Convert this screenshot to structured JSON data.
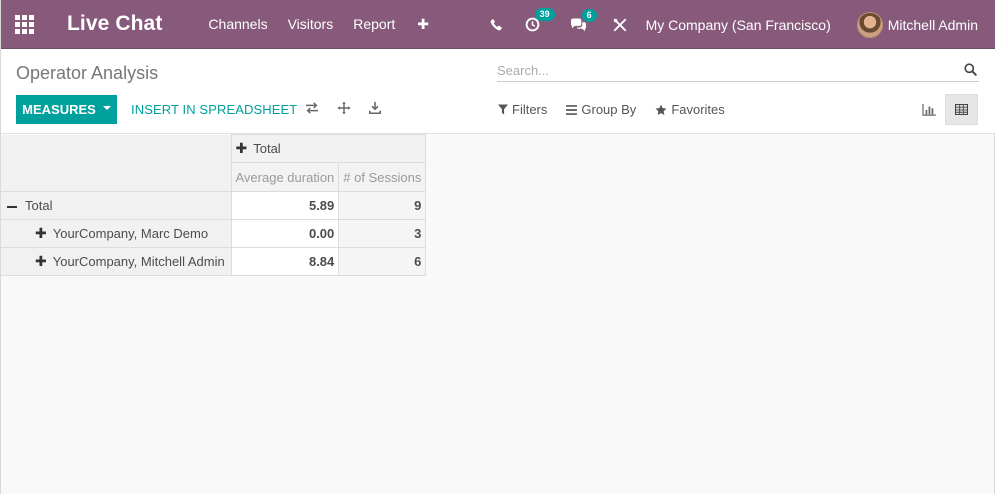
{
  "navbar": {
    "brand": "Live Chat",
    "menu": [
      "Channels",
      "Visitors",
      "Report"
    ],
    "activity_badge": "39",
    "message_badge": "6",
    "company": "My Company (San Francisco)",
    "user": "Mitchell Admin"
  },
  "control_panel": {
    "breadcrumb": "Operator Analysis",
    "search_placeholder": "Search...",
    "measures_label": "MEASURES",
    "spreadsheet_label": "INSERT IN SPREADSHEET",
    "filters_label": "Filters",
    "groupby_label": "Group By",
    "favorites_label": "Favorites",
    "icons": [
      "flip-axis-icon",
      "expand-all-icon",
      "download-icon",
      "bar-chart-icon",
      "table-icon"
    ]
  },
  "pivot": {
    "col_header": "Total",
    "measures": [
      "Average duration",
      "# of Sessions"
    ],
    "total_label": "Total",
    "total_values": [
      "5.89",
      "9"
    ],
    "rows": [
      {
        "label": "YourCompany, Marc Demo",
        "values": [
          "0.00",
          "3"
        ]
      },
      {
        "label": "YourCompany, Mitchell Admin",
        "values": [
          "8.84",
          "6"
        ]
      }
    ]
  },
  "colors": {
    "navbar": "#875a7b",
    "primary": "#00a09d"
  }
}
